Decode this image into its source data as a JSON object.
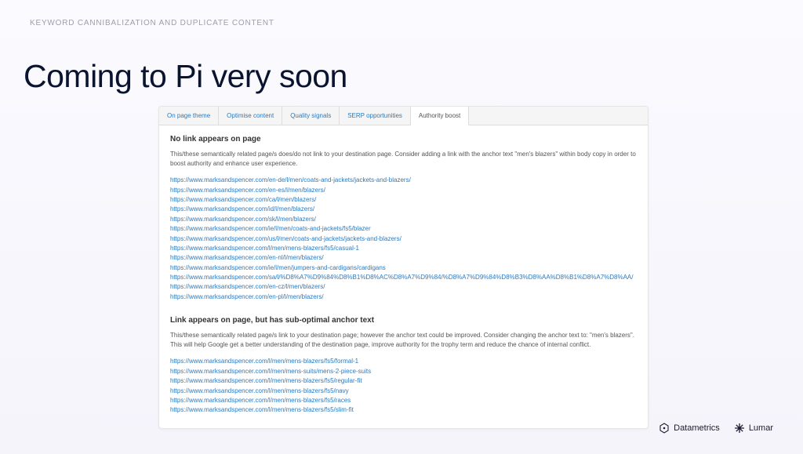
{
  "eyebrow": "KEYWORD CANNIBALIZATION AND DUPLICATE CONTENT",
  "hero": "Coming to Pi very soon",
  "tabs": [
    {
      "label": "On page theme",
      "active": false
    },
    {
      "label": "Optimise content",
      "active": false
    },
    {
      "label": "Quality signals",
      "active": false
    },
    {
      "label": "SERP opportunities",
      "active": false
    },
    {
      "label": "Authority boost",
      "active": true
    }
  ],
  "section1": {
    "heading": "No link appears on page",
    "description": "This/these semantically related page/s does/do not link to your destination page. Consider adding a link with the anchor text \"men's blazers\" within body copy in order to boost authority and enhance user experience.",
    "links": [
      "https://www.marksandspencer.com/en-de/l/men/coats-and-jackets/jackets-and-blazers/",
      "https://www.marksandspencer.com/en-es/l/men/blazers/",
      "https://www.marksandspencer.com/ca/l/men/blazers/",
      "https://www.marksandspencer.com/id/l/men/blazers/",
      "https://www.marksandspencer.com/sk/l/men/blazers/",
      "https://www.marksandspencer.com/ie/l/men/coats-and-jackets/fs5/blazer",
      "https://www.marksandspencer.com/us/l/men/coats-and-jackets/jackets-and-blazers/",
      "https://www.marksandspencer.com/l/men/mens-blazers/fs5/casual-1",
      "https://www.marksandspencer.com/en-nl/l/men/blazers/",
      "https://www.marksandspencer.com/ie/l/men/jumpers-and-cardigans/cardigans",
      "https://www.marksandspencer.com/sa/l/%D8%A7%D9%84%D8%B1%D8%AC%D8%A7%D9%84/%D8%A7%D9%84%D8%B3%D8%AA%D8%B1%D8%A7%D8%AA/",
      "https://www.marksandspencer.com/en-cz/l/men/blazers/",
      "https://www.marksandspencer.com/en-pl/l/men/blazers/"
    ]
  },
  "section2": {
    "heading": "Link appears on page, but has sub-optimal anchor text",
    "description": "This/these semantically related page/s link to your destination page; however the anchor text could be improved. Consider changing the anchor text to: \"men's blazers\". This will help Google get a better understanding of the destination page, improve authority for the trophy term and reduce the chance of internal conflict.",
    "links": [
      "https://www.marksandspencer.com/l/men/mens-blazers/fs5/formal-1",
      "https://www.marksandspencer.com/l/men/mens-suits/mens-2-piece-suits",
      "https://www.marksandspencer.com/l/men/mens-blazers/fs5/regular-fit",
      "https://www.marksandspencer.com/l/men/mens-blazers/fs5/navy",
      "https://www.marksandspencer.com/l/men/mens-blazers/fs5/races",
      "https://www.marksandspencer.com/l/men/mens-blazers/fs5/slim-fit"
    ]
  },
  "brands": {
    "first": "Datametrics",
    "second": "Lumar"
  }
}
